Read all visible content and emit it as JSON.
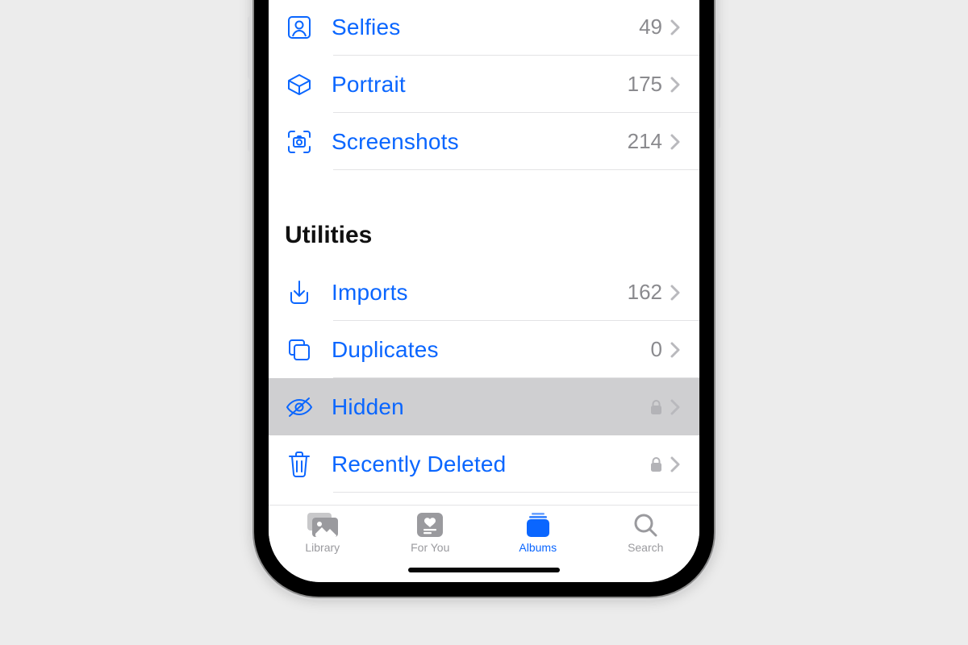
{
  "media_types": [
    {
      "id": "selfies",
      "label": "Selfies",
      "count": "49"
    },
    {
      "id": "portrait",
      "label": "Portrait",
      "count": "175"
    },
    {
      "id": "screenshots",
      "label": "Screenshots",
      "count": "214"
    }
  ],
  "utilities_header": "Utilities",
  "utilities": [
    {
      "id": "imports",
      "label": "Imports",
      "count": "162",
      "locked": false,
      "highlighted": false
    },
    {
      "id": "duplicates",
      "label": "Duplicates",
      "count": "0",
      "locked": false,
      "highlighted": false
    },
    {
      "id": "hidden",
      "label": "Hidden",
      "count": "",
      "locked": true,
      "highlighted": true
    },
    {
      "id": "recently_deleted",
      "label": "Recently Deleted",
      "count": "",
      "locked": true,
      "highlighted": false
    }
  ],
  "tabs": {
    "library": "Library",
    "for_you": "For You",
    "albums": "Albums",
    "search": "Search"
  }
}
